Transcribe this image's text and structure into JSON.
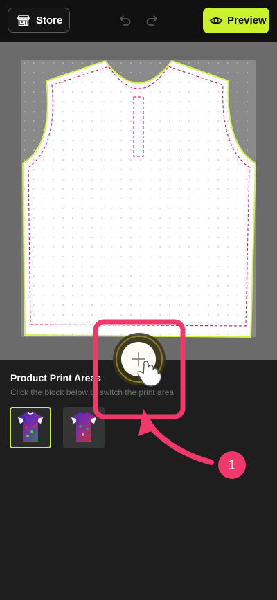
{
  "header": {
    "store_label": "Store",
    "preview_label": "Preview",
    "store_icon": "store-icon",
    "undo_icon": "undo-icon",
    "redo_icon": "redo-icon",
    "preview_icon": "eye-icon",
    "accent_color": "#c9f22d"
  },
  "panel": {
    "title": "Product Print Areas",
    "subtitle": "Click the block below to switch the print area",
    "thumbnails": [
      {
        "selected": true
      },
      {
        "selected": false
      }
    ]
  },
  "annotation": {
    "step_number": "1",
    "highlight_color": "#f0386b"
  }
}
